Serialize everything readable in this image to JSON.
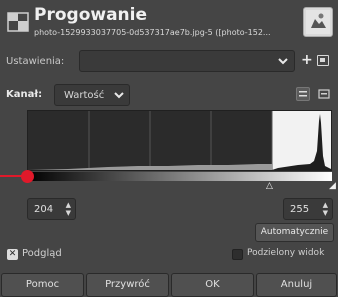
{
  "header": {
    "title": "Progowanie",
    "subtitle": "photo-1529933037705-0d537317ae7b.jpg-5 ([photo-152..."
  },
  "presets": {
    "label": "Ustawienia:",
    "value": ""
  },
  "channel": {
    "label": "Kanał:",
    "value": "Wartość"
  },
  "threshold": {
    "low": "204",
    "high": "255"
  },
  "buttons": {
    "auto": "Automatycznie",
    "help": "Pomoc",
    "reset": "Przywróć",
    "ok": "OK",
    "cancel": "Anuluj"
  },
  "checks": {
    "preview": "Podgląd",
    "split": "Podzielony widok"
  },
  "colors": {
    "accent_marker": "#e0192a",
    "background": "#454545"
  }
}
